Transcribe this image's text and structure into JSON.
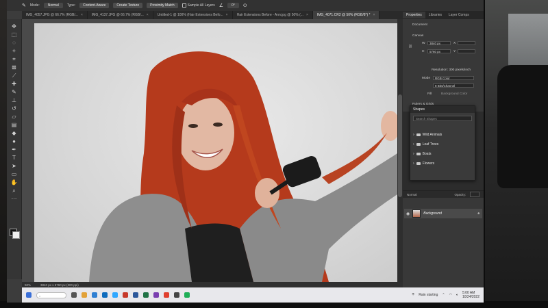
{
  "app": {
    "options_bar": {
      "mode_label": "Mode:",
      "mode_value": "Normal",
      "type_label": "Type:",
      "content_aware": "Content-Aware",
      "create_texture": "Create Texture",
      "proximity_match": "Proximity Match",
      "sample_all_layers": "Sample All Layers",
      "angle_value": "0°"
    },
    "tabs": [
      {
        "label": "IMG_4057.JPG @ 66.7% (RGB/..."
      },
      {
        "label": "IMG_4137.JPG @ 66.7% (RGB/..."
      },
      {
        "label": "Untitled-1 @ 100% (Hair Extensions Befo..."
      },
      {
        "label": "Hair Extensions Before - Ann.jpg @ 50% (..."
      },
      {
        "label": "IMG_4071.CR2 @ 50% (RGB/8*) *"
      }
    ],
    "status": {
      "zoom": "50%",
      "dimensions": "3840 px x 5760 px (300 ppi)"
    }
  },
  "panels": {
    "tabs": [
      "Properties",
      "Libraries",
      "Layer Comps"
    ],
    "properties": {
      "section": "Document",
      "canvas_label": "Canvas",
      "w_label": "W",
      "w_value": "3840 px",
      "h_label": "H",
      "h_value": "5760 px",
      "x_label": "X",
      "y_label": "Y",
      "resolution": "Resolution: 300 pixels/inch",
      "mode_label": "Mode",
      "mode_value": "RGB Color",
      "bit_value": "8 Bits/Channel",
      "fill_label": "Fill",
      "fill_value": "Background Color",
      "rulers_label": "Rulers & Grids"
    },
    "shapes": {
      "title": "Shapes",
      "search_placeholder": "Search Shapes",
      "items": [
        "Wild Animals",
        "Leaf Trees",
        "Boats",
        "Flowers"
      ]
    },
    "layers": {
      "blend_mode": "Normal",
      "opacity_label": "Opacity:",
      "layer_name": "Background"
    }
  },
  "taskbar": {
    "weather": "Rain starting",
    "time": "5:00 AM",
    "date": "10/24/2022"
  },
  "colors": {
    "hair": "#b53a1c",
    "sweater": "#8e8e8e",
    "backdrop": "#dcdcdc",
    "ui_dark": "#323232"
  }
}
